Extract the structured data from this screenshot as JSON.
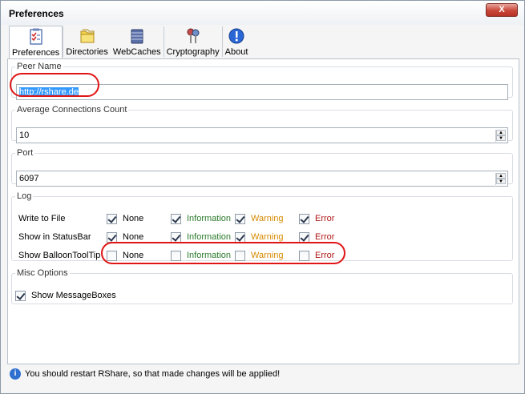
{
  "window": {
    "title": "Preferences",
    "close_label": "X"
  },
  "toolbar": {
    "items": [
      {
        "label": "Preferences",
        "icon": "checklist-icon"
      },
      {
        "label": "Directories",
        "icon": "folder-icon"
      },
      {
        "label": "WebCaches",
        "icon": "database-icon"
      },
      {
        "label": "Cryptography",
        "icon": "keys-icon"
      },
      {
        "label": "About",
        "icon": "info-icon"
      }
    ]
  },
  "peer_name": {
    "legend": "Peer Name",
    "value": "http://rshare.de"
  },
  "avg_connections": {
    "legend": "Average Connections Count",
    "value": "10"
  },
  "port": {
    "legend": "Port",
    "value": "6097"
  },
  "log": {
    "legend": "Log",
    "columns": [
      "None",
      "Information",
      "Warning",
      "Error"
    ],
    "rows": [
      {
        "label": "Write to File",
        "checked": [
          true,
          true,
          true,
          true
        ]
      },
      {
        "label": "Show in StatusBar",
        "checked": [
          true,
          true,
          true,
          true
        ]
      },
      {
        "label": "Show BalloonToolTip",
        "checked": [
          false,
          false,
          false,
          false
        ]
      }
    ]
  },
  "misc": {
    "legend": "Misc Options",
    "show_messageboxes_label": "Show MessageBoxes",
    "show_messageboxes_checked": true
  },
  "status": {
    "text": "You should restart RShare, so that made changes will be applied!"
  },
  "colors": {
    "information": "#2a7a2a",
    "warning": "#d68a00",
    "error": "#b01818",
    "annotation": "#e01616"
  }
}
